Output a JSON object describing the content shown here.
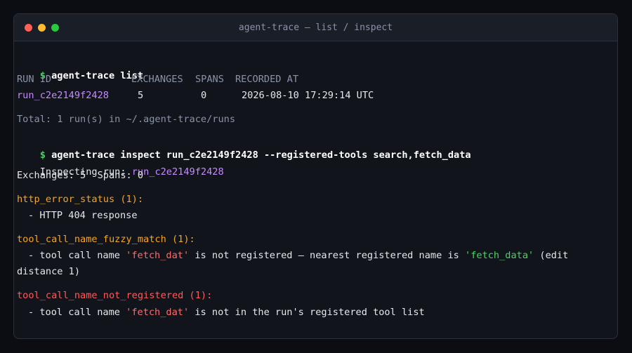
{
  "window": {
    "title": "agent-trace — list / inspect"
  },
  "terminal": {
    "prompt_symbol": "$",
    "cmd1": "agent-trace list",
    "table": {
      "headers": [
        "RUN ID",
        "EXCHANGES",
        "SPANS",
        "RECORDED AT"
      ],
      "rows": [
        [
          "run_c2e2149f2428",
          "5",
          "0",
          "2026-08-10 17:29:14 UTC"
        ]
      ]
    },
    "total_line": "Total: 1 run(s) in ~/.agent-trace/runs",
    "cmd2": "agent-trace inspect run_c2e2149f2428 --registered-tools search,fetch_data",
    "inspecting_label": "Inspecting run:",
    "inspecting_run": "run_c2e2149f2428",
    "exchanges_spans": "Exchanges: 5  Spans: 0",
    "findings": [
      {
        "heading": "http_error_status (1):",
        "severity": "warning",
        "items": [
          {
            "text": "- HTTP 404 response"
          }
        ]
      },
      {
        "heading": "tool_call_name_fuzzy_match (1):",
        "severity": "warning",
        "items": [
          {
            "pre": "- tool call name ",
            "bad": "'fetch_dat'",
            "mid": " is not registered — nearest registered name is ",
            "good": "'fetch_data'",
            "post": " (edit",
            "cont": "distance 1)"
          }
        ]
      },
      {
        "heading": "tool_call_name_not_registered (1):",
        "severity": "error",
        "items": [
          {
            "pre": "- tool call name ",
            "bad": "'fetch_dat'",
            "post": " is not in the run's registered tool list"
          }
        ]
      }
    ],
    "colors": {
      "prompt": "#4cd262",
      "run_id": "#c58bff",
      "warning": "#f5a524",
      "error": "#ff5a5a",
      "muted": "#8a93a8"
    }
  }
}
